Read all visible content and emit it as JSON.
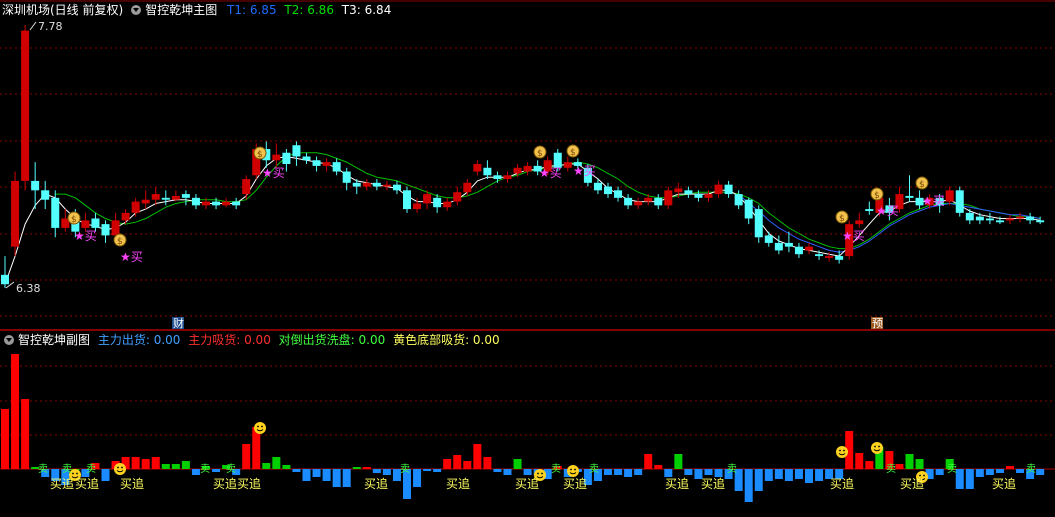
{
  "main_header": {
    "stock_title": "深圳机场(日线 前复权)",
    "indicator_name": "智控乾坤主图",
    "t1_label": "T1: 6.85",
    "t2_label": "T2: 6.86",
    "t3_label": "T3: 6.84"
  },
  "sub_header": {
    "indicator_name": "智控乾坤副图",
    "main_out_label": "主力出货: 0.00",
    "main_in_label": "主力吸货: 0.00",
    "hedge_wash_label": "对倒出货洗盘: 0.00",
    "yellow_bottom_label": "黄色底部吸货: 0.00"
  },
  "price_labels": {
    "high": "7.78",
    "low": "6.38"
  },
  "event_markers": {
    "finance": "财",
    "forecast": "预"
  },
  "signal_text": {
    "buy": "★买",
    "buy_chase": "买追",
    "sell": "卖"
  },
  "colors": {
    "up": "#d00000",
    "down": "#54ffff",
    "ma_white": "#ffffff",
    "ma_green": "#00c000",
    "ma_blue": "#3060ff",
    "red_bar": "#ff0000",
    "green_bar": "#00d000",
    "blue_bar": "#1a8cff",
    "grid": "#8a0000",
    "t1": "#1e6bff",
    "t2": "#00e000",
    "t3": "#ffffff",
    "main_out": "#40a0ff",
    "main_in": "#ff3030",
    "hedge": "#40ff40",
    "yellow_bottom": "#ffff60"
  },
  "chart_data": {
    "type": "candlestick",
    "price_range": [
      6.38,
      7.78
    ],
    "candles": [
      [
        6.45,
        6.4,
        6.55,
        6.38
      ],
      [
        6.6,
        6.95,
        7.0,
        6.55
      ],
      [
        6.95,
        7.75,
        7.78,
        6.9
      ],
      [
        6.95,
        6.9,
        7.05,
        6.8
      ],
      [
        6.9,
        6.85,
        6.95,
        6.8
      ],
      [
        6.86,
        6.7,
        6.9,
        6.65
      ],
      [
        6.7,
        6.75,
        6.8,
        6.68
      ],
      [
        6.76,
        6.68,
        6.8,
        6.65
      ],
      [
        6.7,
        6.74,
        6.78,
        6.68
      ],
      [
        6.75,
        6.7,
        6.78,
        6.68
      ],
      [
        6.72,
        6.66,
        6.74,
        6.62
      ],
      [
        6.66,
        6.74,
        6.78,
        6.64
      ],
      [
        6.74,
        6.78,
        6.8,
        6.72
      ],
      [
        6.78,
        6.84,
        6.86,
        6.76
      ],
      [
        6.83,
        6.85,
        6.9,
        6.8
      ],
      [
        6.85,
        6.88,
        6.92,
        6.82
      ],
      [
        6.86,
        6.85,
        6.9,
        6.82
      ],
      [
        6.85,
        6.87,
        6.9,
        6.84
      ],
      [
        6.88,
        6.86,
        6.9,
        6.82
      ],
      [
        6.86,
        6.82,
        6.88,
        6.8
      ],
      [
        6.82,
        6.84,
        6.86,
        6.8
      ],
      [
        6.84,
        6.82,
        6.86,
        6.8
      ],
      [
        6.82,
        6.84,
        6.86,
        6.81
      ],
      [
        6.84,
        6.82,
        6.86,
        6.8
      ],
      [
        6.88,
        6.96,
        6.98,
        6.85
      ],
      [
        6.98,
        7.12,
        7.15,
        6.96
      ],
      [
        7.12,
        7.06,
        7.16,
        7.02
      ],
      [
        7.06,
        7.09,
        7.15,
        7.02
      ],
      [
        7.1,
        7.04,
        7.12,
        7.0
      ],
      [
        7.14,
        7.08,
        7.16,
        7.03
      ],
      [
        7.08,
        7.06,
        7.1,
        7.04
      ],
      [
        7.06,
        7.03,
        7.08,
        7.0
      ],
      [
        7.03,
        7.05,
        7.07,
        7.0
      ],
      [
        7.05,
        7.0,
        7.07,
        6.98
      ],
      [
        7.0,
        6.94,
        7.02,
        6.9
      ],
      [
        6.94,
        6.92,
        6.96,
        6.88
      ],
      [
        6.92,
        6.94,
        6.96,
        6.9
      ],
      [
        6.94,
        6.92,
        6.96,
        6.9
      ],
      [
        6.92,
        6.93,
        6.95,
        6.9
      ],
      [
        6.93,
        6.9,
        6.95,
        6.88
      ],
      [
        6.9,
        6.8,
        6.92,
        6.78
      ],
      [
        6.8,
        6.83,
        6.86,
        6.78
      ],
      [
        6.83,
        6.88,
        6.9,
        6.8
      ],
      [
        6.86,
        6.81,
        6.88,
        6.78
      ],
      [
        6.81,
        6.84,
        6.86,
        6.79
      ],
      [
        6.84,
        6.89,
        6.92,
        6.82
      ],
      [
        6.89,
        6.94,
        6.96,
        6.87
      ],
      [
        7.0,
        7.04,
        7.06,
        6.98
      ],
      [
        7.02,
        6.98,
        7.06,
        6.96
      ],
      [
        6.98,
        6.96,
        7.0,
        6.94
      ],
      [
        6.96,
        6.98,
        7.0,
        6.94
      ],
      [
        6.99,
        7.02,
        7.04,
        6.97
      ],
      [
        7.0,
        7.03,
        7.05,
        6.98
      ],
      [
        7.03,
        7.0,
        7.06,
        6.98
      ],
      [
        7.0,
        7.06,
        7.08,
        6.98
      ],
      [
        7.1,
        7.02,
        7.12,
        7.0
      ],
      [
        7.02,
        7.05,
        7.08,
        7.0
      ],
      [
        7.05,
        7.03,
        7.07,
        7.0
      ],
      [
        7.02,
        6.94,
        7.04,
        6.92
      ],
      [
        6.94,
        6.9,
        6.96,
        6.88
      ],
      [
        6.92,
        6.88,
        6.94,
        6.86
      ],
      [
        6.9,
        6.86,
        6.92,
        6.84
      ],
      [
        6.86,
        6.82,
        6.88,
        6.8
      ],
      [
        6.82,
        6.84,
        6.86,
        6.8
      ],
      [
        6.84,
        6.86,
        6.88,
        6.82
      ],
      [
        6.86,
        6.82,
        6.88,
        6.8
      ],
      [
        6.82,
        6.9,
        6.92,
        6.8
      ],
      [
        6.89,
        6.91,
        6.94,
        6.86
      ],
      [
        6.9,
        6.88,
        6.92,
        6.86
      ],
      [
        6.88,
        6.86,
        6.9,
        6.84
      ],
      [
        6.86,
        6.88,
        6.9,
        6.84
      ],
      [
        6.88,
        6.93,
        6.95,
        6.86
      ],
      [
        6.93,
        6.88,
        6.95,
        6.86
      ],
      [
        6.88,
        6.82,
        6.9,
        6.8
      ],
      [
        6.85,
        6.75,
        6.86,
        6.72
      ],
      [
        6.8,
        6.65,
        6.82,
        6.62
      ],
      [
        6.66,
        6.62,
        6.68,
        6.6
      ],
      [
        6.62,
        6.58,
        6.66,
        6.56
      ],
      [
        6.62,
        6.6,
        6.68,
        6.57
      ],
      [
        6.6,
        6.56,
        6.62,
        6.54
      ],
      [
        6.58,
        6.6,
        6.62,
        6.56
      ],
      [
        6.56,
        6.55,
        6.58,
        6.53
      ],
      [
        6.54,
        6.55,
        6.57,
        6.52
      ],
      [
        6.55,
        6.53,
        6.58,
        6.51
      ],
      [
        6.55,
        6.72,
        6.74,
        6.53
      ],
      [
        6.72,
        6.74,
        6.78,
        6.7
      ],
      [
        6.8,
        6.79,
        6.84,
        6.77
      ],
      [
        6.78,
        6.86,
        6.9,
        6.76
      ],
      [
        6.82,
        6.78,
        6.86,
        6.74
      ],
      [
        6.8,
        6.88,
        6.92,
        6.78
      ],
      [
        6.87,
        6.86,
        6.98,
        6.84
      ],
      [
        6.86,
        6.82,
        6.9,
        6.8
      ],
      [
        6.82,
        6.86,
        6.88,
        6.8
      ],
      [
        6.86,
        6.82,
        6.88,
        6.78
      ],
      [
        6.84,
        6.9,
        6.92,
        6.82
      ],
      [
        6.9,
        6.78,
        6.92,
        6.76
      ],
      [
        6.78,
        6.74,
        6.8,
        6.72
      ],
      [
        6.76,
        6.74,
        6.78,
        6.72
      ],
      [
        6.75,
        6.74,
        6.78,
        6.72
      ],
      [
        6.74,
        6.73,
        6.76,
        6.72
      ],
      [
        6.74,
        6.75,
        6.77,
        6.72
      ],
      [
        6.75,
        6.76,
        6.78,
        6.73
      ],
      [
        6.76,
        6.74,
        6.78,
        6.72
      ],
      [
        6.74,
        6.73,
        6.76,
        6.72
      ]
    ],
    "ma_white": [
      6.4,
      6.55,
      6.72,
      6.82,
      6.88,
      6.86,
      6.8,
      6.75,
      6.72,
      6.71,
      6.69,
      6.7,
      6.73,
      6.78,
      6.8,
      6.83,
      6.84,
      6.85,
      6.85,
      6.84,
      6.83,
      6.83,
      6.83,
      6.83,
      6.87,
      6.96,
      7.03,
      7.07,
      7.08,
      7.07,
      7.06,
      7.05,
      7.04,
      7.02,
      6.98,
      6.95,
      6.94,
      6.93,
      6.92,
      6.91,
      6.87,
      6.84,
      6.84,
      6.83,
      6.83,
      6.85,
      6.89,
      6.95,
      6.97,
      6.97,
      6.97,
      6.99,
      7.01,
      7.01,
      7.03,
      7.03,
      7.04,
      7.04,
      7.0,
      6.96,
      6.91,
      6.88,
      6.85,
      6.84,
      6.84,
      6.84,
      6.86,
      6.88,
      6.88,
      6.88,
      6.88,
      6.9,
      6.9,
      6.87,
      6.81,
      6.74,
      6.67,
      6.63,
      6.61,
      6.59,
      6.58,
      6.57,
      6.56,
      6.55,
      6.6,
      6.66,
      6.72,
      6.78,
      6.79,
      6.82,
      6.84,
      6.84,
      6.84,
      6.84,
      6.85,
      6.82,
      6.79,
      6.77,
      6.76,
      6.75,
      6.75,
      6.75,
      6.75,
      6.74
    ],
    "ma_green": [
      null,
      null,
      null,
      null,
      null,
      6.88,
      6.88,
      6.86,
      6.82,
      6.78,
      6.75,
      6.73,
      6.72,
      6.73,
      6.75,
      6.78,
      6.81,
      6.83,
      6.84,
      6.85,
      6.85,
      6.85,
      6.84,
      6.84,
      6.85,
      6.9,
      6.97,
      7.03,
      7.08,
      7.1,
      7.1,
      7.1,
      7.09,
      7.07,
      7.05,
      7.02,
      6.99,
      6.97,
      6.96,
      6.95,
      6.93,
      6.91,
      6.89,
      6.87,
      6.86,
      6.86,
      6.87,
      6.89,
      6.92,
      6.95,
      6.97,
      6.98,
      7.0,
      7.01,
      7.02,
      7.03,
      7.04,
      7.05,
      7.04,
      7.02,
      6.99,
      6.96,
      6.92,
      6.89,
      6.87,
      6.86,
      6.86,
      6.87,
      6.88,
      6.89,
      6.89,
      6.89,
      6.89,
      6.88,
      6.86,
      6.83,
      6.78,
      6.74,
      6.7,
      6.67,
      6.64,
      6.62,
      6.6,
      6.59,
      6.59,
      6.61,
      6.64,
      6.68,
      6.72,
      6.75,
      6.78,
      6.8,
      6.82,
      6.83,
      6.83,
      6.83,
      6.82,
      6.8,
      6.79,
      6.78,
      6.77,
      6.76,
      6.76,
      6.75
    ],
    "ma_blue": [
      null,
      null,
      null,
      null,
      null,
      null,
      null,
      null,
      null,
      null,
      null,
      null,
      null,
      null,
      null,
      null,
      null,
      null,
      null,
      null,
      null,
      null,
      null,
      null,
      null,
      null,
      null,
      null,
      null,
      null,
      null,
      null,
      null,
      null,
      null,
      null,
      null,
      null,
      null,
      null,
      null,
      null,
      null,
      null,
      null,
      null,
      null,
      null,
      null,
      null,
      null,
      null,
      null,
      null,
      null,
      null,
      null,
      null,
      null,
      null,
      null,
      null,
      null,
      null,
      null,
      null,
      null,
      null,
      null,
      null,
      null,
      null,
      null,
      6.88,
      6.83,
      6.79,
      6.74,
      6.7,
      6.67,
      6.64,
      6.62,
      6.6,
      6.58,
      6.57,
      6.58,
      6.6,
      6.63,
      6.67,
      6.71,
      6.74,
      6.77,
      6.79,
      6.81,
      6.82,
      6.83,
      6.82,
      6.81,
      6.8,
      6.79,
      6.78,
      6.77,
      6.77,
      6.76,
      6.75
    ],
    "sub_bars": [
      [
        "r",
        60
      ],
      [
        "r",
        115
      ],
      [
        "r",
        70
      ],
      [
        "g",
        2
      ],
      [
        "b",
        -8
      ],
      [
        "b",
        -12
      ],
      [
        "b",
        -16
      ],
      [
        "g",
        -3
      ],
      [
        "b",
        -8
      ],
      [
        "r",
        6
      ],
      [
        "b",
        -12
      ],
      [
        "r",
        8
      ],
      [
        "r",
        12
      ],
      [
        "r",
        12
      ],
      [
        "r",
        10
      ],
      [
        "r",
        12
      ],
      [
        "g",
        5
      ],
      [
        "g",
        5
      ],
      [
        "g",
        8
      ],
      [
        "b",
        -6
      ],
      [
        "g",
        3
      ],
      [
        "b",
        -3
      ],
      [
        "g",
        4
      ],
      [
        "b",
        -6
      ],
      [
        "r",
        25
      ],
      [
        "r",
        42
      ],
      [
        "g",
        6
      ],
      [
        "g",
        12
      ],
      [
        "g",
        4
      ],
      [
        "b",
        -3
      ],
      [
        "b",
        -12
      ],
      [
        "b",
        -8
      ],
      [
        "b",
        -12
      ],
      [
        "b",
        -18
      ],
      [
        "b",
        -18
      ],
      [
        "g",
        2
      ],
      [
        "r",
        2
      ],
      [
        "b",
        -4
      ],
      [
        "b",
        -6
      ],
      [
        "b",
        -12
      ],
      [
        "b",
        -30
      ],
      [
        "b",
        -18
      ],
      [
        "b",
        -2
      ],
      [
        "b",
        -3
      ],
      [
        "r",
        10
      ],
      [
        "r",
        14
      ],
      [
        "r",
        8
      ],
      [
        "r",
        25
      ],
      [
        "r",
        12
      ],
      [
        "b",
        -3
      ],
      [
        "b",
        -6
      ],
      [
        "g",
        10
      ],
      [
        "b",
        -6
      ],
      [
        "b",
        -6
      ],
      [
        "b",
        -10
      ],
      [
        "r",
        3
      ],
      [
        "b",
        -8
      ],
      [
        "b",
        -3
      ],
      [
        "b",
        -16
      ],
      [
        "b",
        -12
      ],
      [
        "b",
        -6
      ],
      [
        "b",
        -6
      ],
      [
        "b",
        -8
      ],
      [
        "b",
        -6
      ],
      [
        "r",
        15
      ],
      [
        "r",
        4
      ],
      [
        "b",
        -8
      ],
      [
        "g",
        15
      ],
      [
        "b",
        -6
      ],
      [
        "b",
        -10
      ],
      [
        "b",
        -6
      ],
      [
        "b",
        -8
      ],
      [
        "b",
        -10
      ],
      [
        "b",
        -22
      ],
      [
        "b",
        -33
      ],
      [
        "b",
        -22
      ],
      [
        "b",
        -12
      ],
      [
        "b",
        -10
      ],
      [
        "b",
        -12
      ],
      [
        "b",
        -10
      ],
      [
        "b",
        -14
      ],
      [
        "b",
        -12
      ],
      [
        "b",
        -10
      ],
      [
        "b",
        -10
      ],
      [
        "r",
        38
      ],
      [
        "r",
        16
      ],
      [
        "r",
        8
      ],
      [
        "g",
        22
      ],
      [
        "r",
        18
      ],
      [
        "r",
        5
      ],
      [
        "g",
        15
      ],
      [
        "g",
        10
      ],
      [
        "b",
        -10
      ],
      [
        "b",
        -6
      ],
      [
        "g",
        10
      ],
      [
        "b",
        -20
      ],
      [
        "b",
        -20
      ],
      [
        "b",
        -8
      ],
      [
        "b",
        -6
      ],
      [
        "b",
        -4
      ],
      [
        "r",
        3
      ],
      [
        "b",
        -4
      ],
      [
        "b",
        -10
      ],
      [
        "b",
        -6
      ]
    ]
  }
}
